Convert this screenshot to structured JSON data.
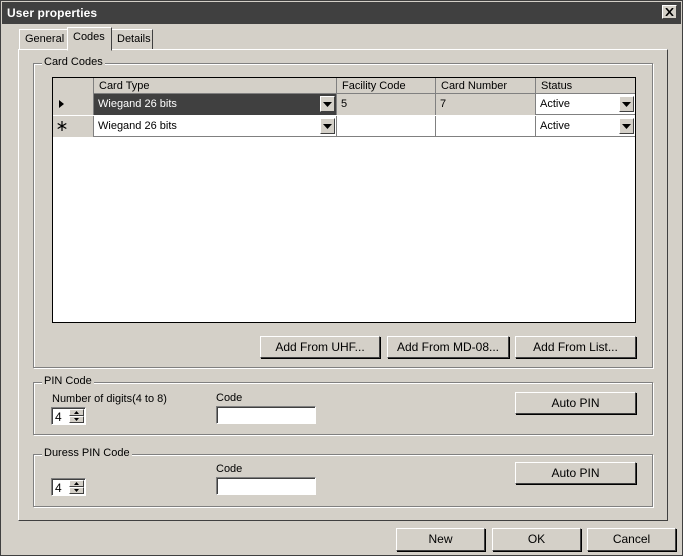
{
  "window": {
    "title": "User properties"
  },
  "tabs": [
    {
      "label": "General"
    },
    {
      "label": "Codes"
    },
    {
      "label": "Details"
    }
  ],
  "card_codes": {
    "legend": "Card Codes",
    "columns": [
      "Card Type",
      "Facility Code",
      "Card Number",
      "Status"
    ],
    "rows": [
      {
        "indicator": "current-row",
        "card_type": "Wiegand 26 bits",
        "facility_code": "5",
        "card_number": "7",
        "status": "Active"
      },
      {
        "indicator": "new-row",
        "card_type": "Wiegand 26 bits",
        "facility_code": "",
        "card_number": "",
        "status": "Active"
      }
    ],
    "add_from_uhf_label": "Add From UHF...",
    "add_from_md08_label": "Add From MD-08...",
    "add_from_list_label": "Add From List..."
  },
  "pin_code": {
    "legend": "PIN Code",
    "digits_label": "Number of digits(4 to 8)",
    "digits_value": "4",
    "code_label": "Code",
    "code_value": "",
    "auto_pin_label": "Auto PIN"
  },
  "duress_pin": {
    "legend": "Duress PIN Code",
    "digits_value": "4",
    "code_label": "Code",
    "code_value": "",
    "auto_pin_label": "Auto PIN"
  },
  "footer": {
    "new_label": "New",
    "ok_label": "OK",
    "cancel_label": "Cancel"
  }
}
